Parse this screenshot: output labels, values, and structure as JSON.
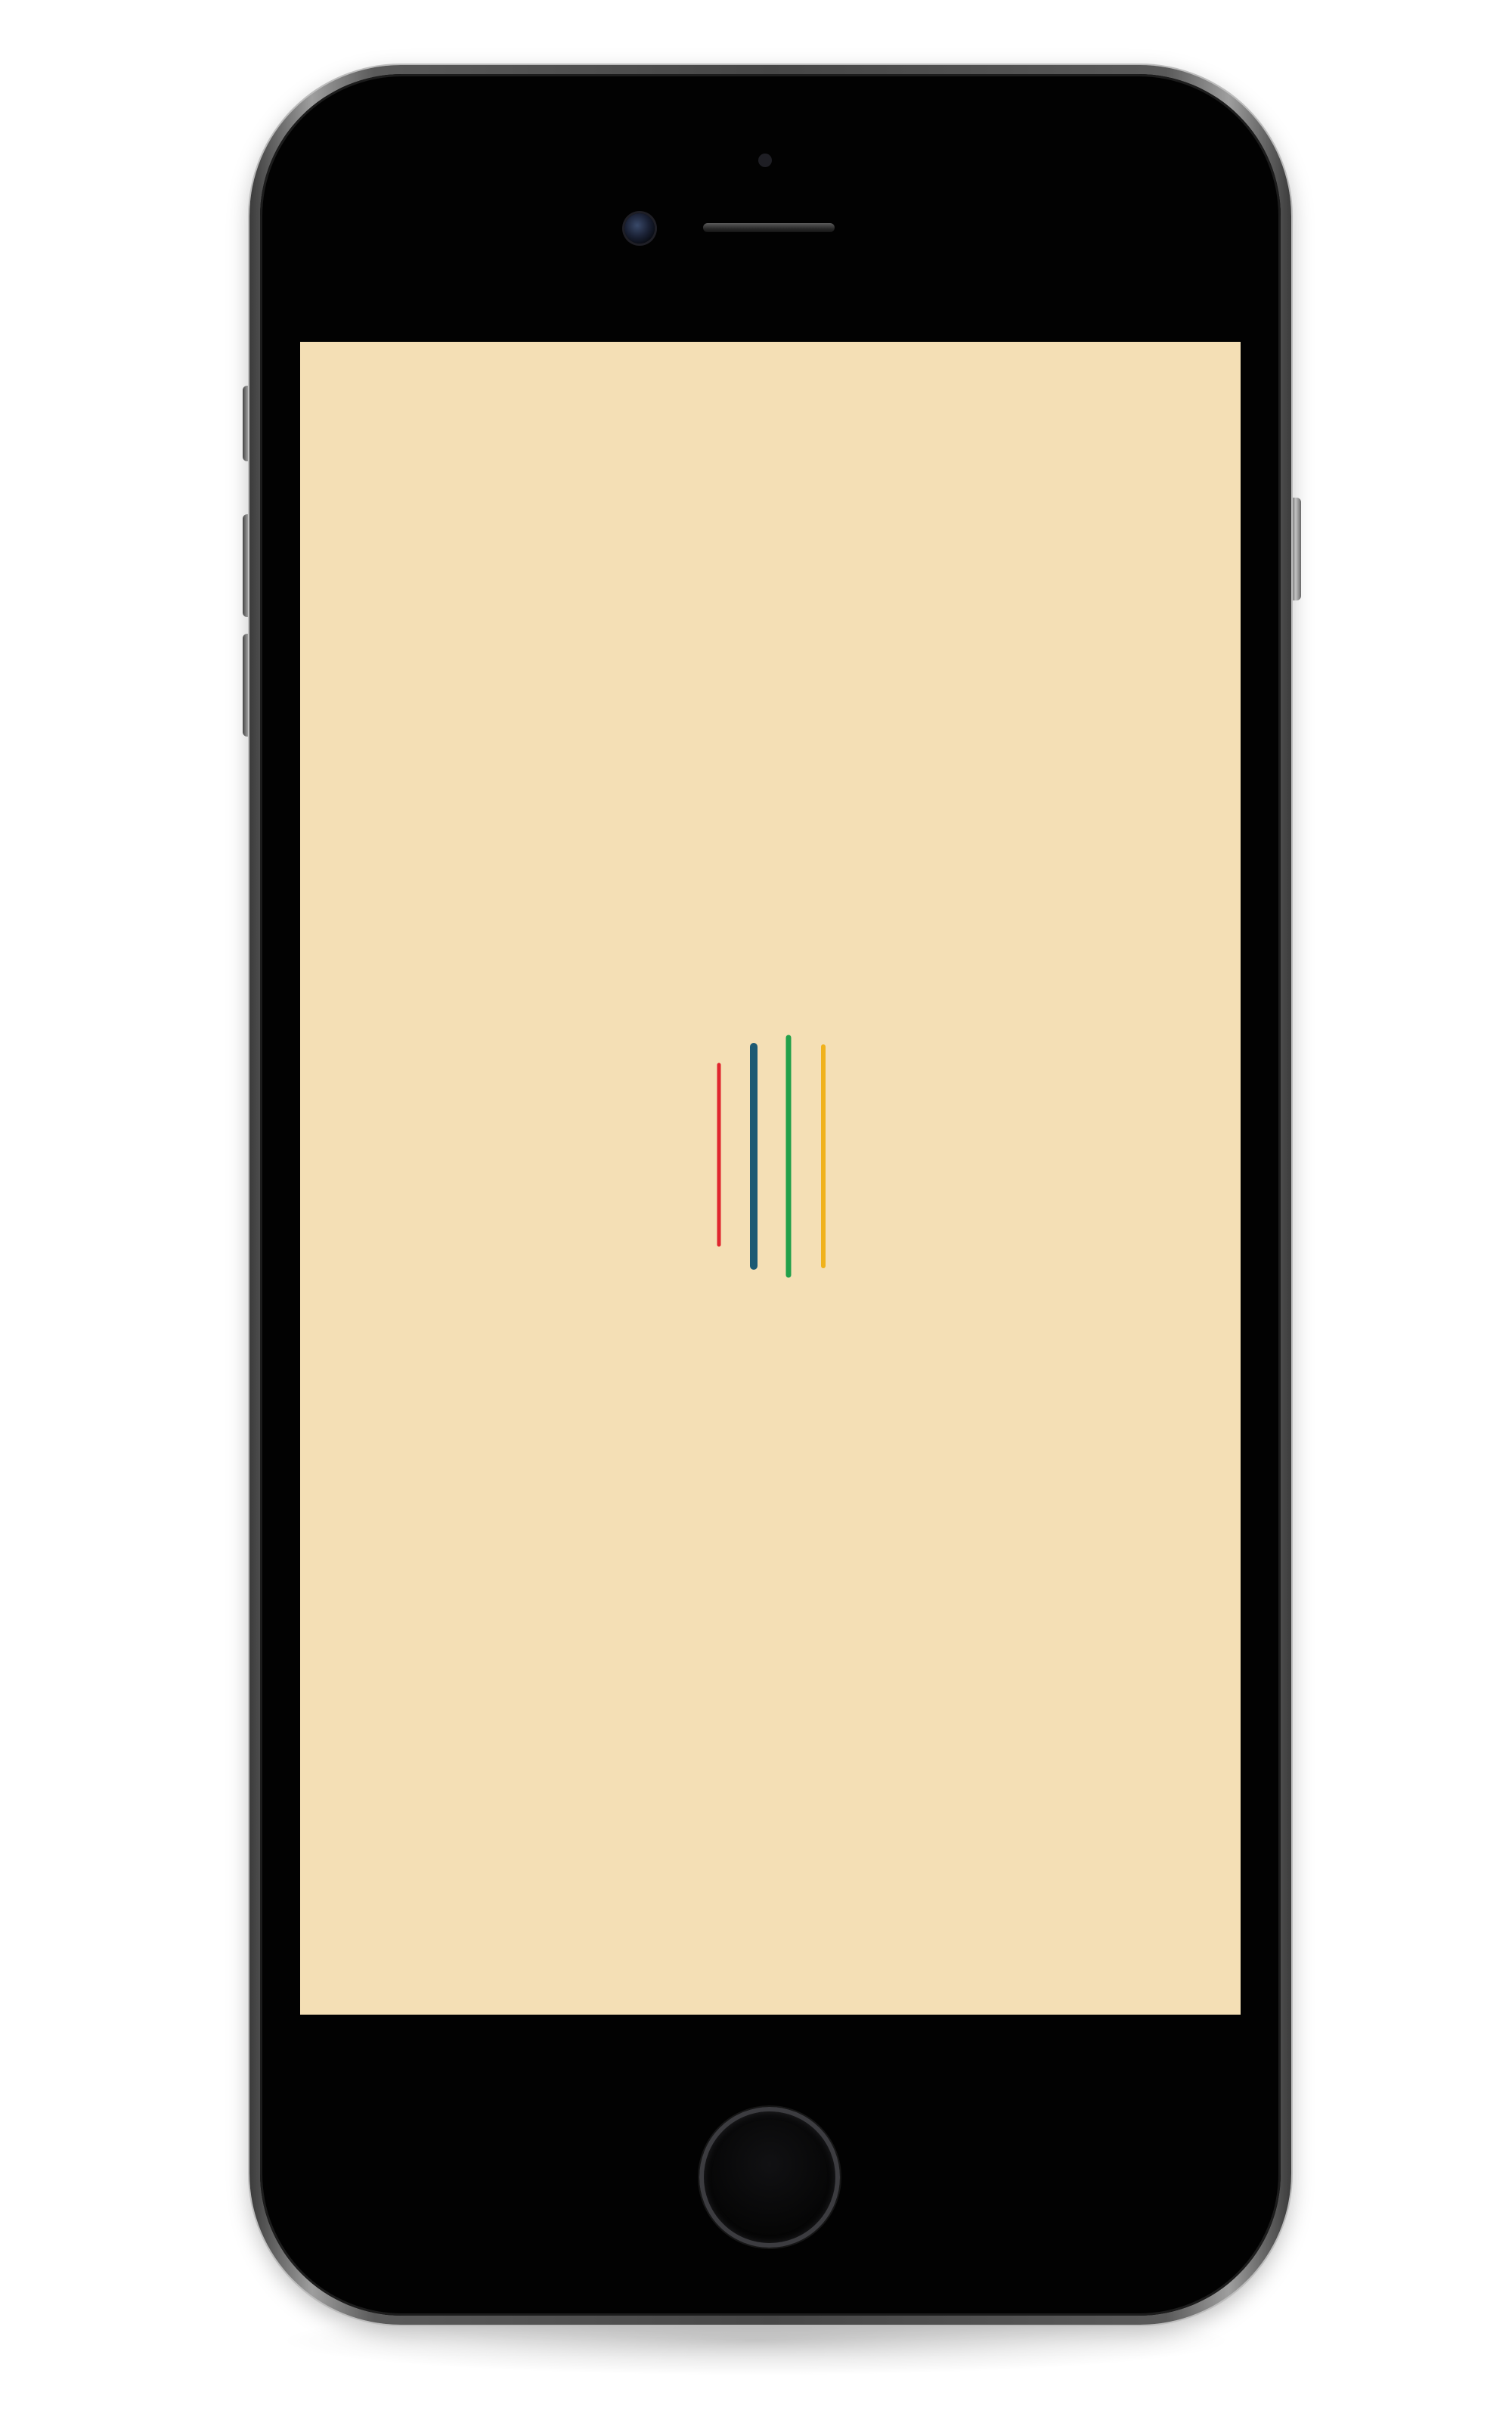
{
  "device": {
    "model": "smartphone",
    "frame_color": "#4a4a4a",
    "body_color": "#020202"
  },
  "screen": {
    "background_color": "#f4dfb5",
    "state": "loading"
  },
  "loader": {
    "type": "vertical-bars-spinner",
    "bars": [
      {
        "color": "#e0262e"
      },
      {
        "color": "#1d5a73"
      },
      {
        "color": "#22a04a"
      },
      {
        "color": "#f0b21c"
      }
    ]
  },
  "home_button": {
    "icon": "home-button-icon"
  }
}
